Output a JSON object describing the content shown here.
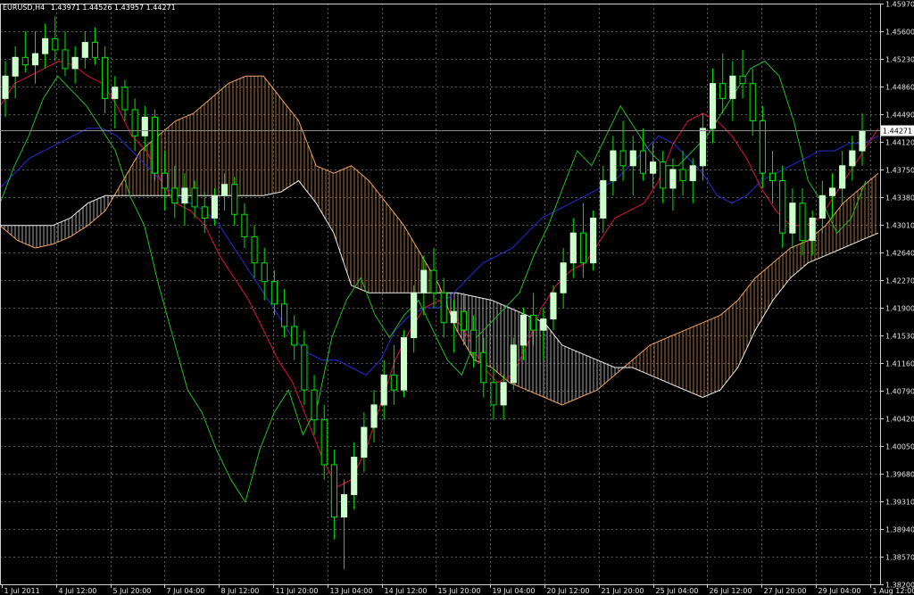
{
  "header": {
    "symbol_tf": "EURUSD,H4",
    "ohlc": "1.43971 1.44526 1.43957 1.44271"
  },
  "current_price_label": "1.44271",
  "colors": {
    "background": "#000000",
    "grid": "#5a5a5a",
    "axis": "#cfcfcf",
    "bull": "#ccffcc",
    "bear": "#228B22",
    "wick": "#00e600",
    "tenkan": "#e0103c",
    "kijun": "#2a2ad8",
    "chikou": "#22bb22",
    "cloud_bull": "#f4a460",
    "cloud_bear": "#f0f0f0"
  },
  "chart_data": {
    "type": "candlestick",
    "ylim": [
      1.382,
      1.4597
    ],
    "y_ticks": [
      "1.45970",
      "1.45600",
      "1.45230",
      "1.44860",
      "1.44490",
      "1.44120",
      "1.43750",
      "1.43380",
      "1.43010",
      "1.42640",
      "1.42270",
      "1.41900",
      "1.41530",
      "1.41160",
      "1.40790",
      "1.40420",
      "1.40050",
      "1.39680",
      "1.39310",
      "1.38940",
      "1.38570",
      "1.38200"
    ],
    "x_ticks": [
      "1 Jul 2011",
      "4 Jul 12:00",
      "5 Jul 20:00",
      "7 Jul 04:00",
      "8 Jul 12:00",
      "11 Jul 20:00",
      "13 Jul 04:00",
      "14 Jul 12:00",
      "15 Jul 20:00",
      "19 Jul 04:00",
      "20 Jul 12:00",
      "21 Jul 20:00",
      "25 Jul 04:00",
      "26 Jul 12:00",
      "27 Jul 20:00",
      "29 Jul 04:00",
      "1 Aug 12:00"
    ],
    "last_price": 1.44271,
    "candles_ohlc": [
      [
        1.447,
        1.452,
        1.4445,
        1.45
      ],
      [
        1.45,
        1.454,
        1.447,
        1.4525
      ],
      [
        1.4525,
        1.456,
        1.4505,
        1.4515
      ],
      [
        1.4515,
        1.456,
        1.449,
        1.453
      ],
      [
        1.453,
        1.457,
        1.451,
        1.455
      ],
      [
        1.455,
        1.458,
        1.452,
        1.4535
      ],
      [
        1.4535,
        1.456,
        1.45,
        1.451
      ],
      [
        1.451,
        1.454,
        1.449,
        1.4525
      ],
      [
        1.4525,
        1.456,
        1.451,
        1.4545
      ],
      [
        1.4545,
        1.4565,
        1.4515,
        1.4525
      ],
      [
        1.4525,
        1.454,
        1.445,
        1.447
      ],
      [
        1.447,
        1.45,
        1.443,
        1.4485
      ],
      [
        1.4485,
        1.4495,
        1.444,
        1.4455
      ],
      [
        1.4455,
        1.447,
        1.44,
        1.442
      ],
      [
        1.442,
        1.446,
        1.44,
        1.4445
      ],
      [
        1.4445,
        1.4455,
        1.436,
        1.437
      ],
      [
        1.437,
        1.44,
        1.432,
        1.435
      ],
      [
        1.435,
        1.438,
        1.431,
        1.433
      ],
      [
        1.433,
        1.437,
        1.43,
        1.435
      ],
      [
        1.435,
        1.436,
        1.431,
        1.4325
      ],
      [
        1.4325,
        1.4345,
        1.429,
        1.431
      ],
      [
        1.431,
        1.435,
        1.43,
        1.434
      ],
      [
        1.434,
        1.437,
        1.432,
        1.4355
      ],
      [
        1.4355,
        1.4365,
        1.43,
        1.4315
      ],
      [
        1.4315,
        1.433,
        1.427,
        1.4285
      ],
      [
        1.4285,
        1.43,
        1.423,
        1.425
      ],
      [
        1.425,
        1.427,
        1.42,
        1.4225
      ],
      [
        1.4225,
        1.424,
        1.418,
        1.4195
      ],
      [
        1.4195,
        1.4215,
        1.415,
        1.4165
      ],
      [
        1.4165,
        1.418,
        1.412,
        1.414
      ],
      [
        1.414,
        1.416,
        1.406,
        1.408
      ],
      [
        1.408,
        1.41,
        1.402,
        1.404
      ],
      [
        1.404,
        1.406,
        1.396,
        1.398
      ],
      [
        1.398,
        1.4,
        1.388,
        1.391
      ],
      [
        1.391,
        1.396,
        1.384,
        1.394
      ],
      [
        1.394,
        1.401,
        1.392,
        1.399
      ],
      [
        1.399,
        1.405,
        1.397,
        1.403
      ],
      [
        1.403,
        1.408,
        1.401,
        1.406
      ],
      [
        1.406,
        1.412,
        1.404,
        1.41
      ],
      [
        1.41,
        1.414,
        1.406,
        1.408
      ],
      [
        1.408,
        1.416,
        1.407,
        1.415
      ],
      [
        1.415,
        1.422,
        1.413,
        1.421
      ],
      [
        1.421,
        1.426,
        1.418,
        1.424
      ],
      [
        1.424,
        1.427,
        1.419,
        1.421
      ],
      [
        1.421,
        1.423,
        1.415,
        1.417
      ],
      [
        1.417,
        1.42,
        1.413,
        1.4185
      ],
      [
        1.4185,
        1.421,
        1.414,
        1.416
      ],
      [
        1.416,
        1.418,
        1.411,
        1.413
      ],
      [
        1.413,
        1.415,
        1.407,
        1.409
      ],
      [
        1.409,
        1.411,
        1.404,
        1.406
      ],
      [
        1.406,
        1.41,
        1.404,
        1.409
      ],
      [
        1.409,
        1.415,
        1.408,
        1.414
      ],
      [
        1.414,
        1.419,
        1.412,
        1.418
      ],
      [
        1.418,
        1.421,
        1.414,
        1.416
      ],
      [
        1.416,
        1.419,
        1.412,
        1.4175
      ],
      [
        1.4175,
        1.422,
        1.416,
        1.421
      ],
      [
        1.421,
        1.427,
        1.419,
        1.425
      ],
      [
        1.425,
        1.431,
        1.423,
        1.429
      ],
      [
        1.429,
        1.433,
        1.423,
        1.425
      ],
      [
        1.425,
        1.432,
        1.424,
        1.431
      ],
      [
        1.431,
        1.438,
        1.429,
        1.436
      ],
      [
        1.436,
        1.442,
        1.434,
        1.44
      ],
      [
        1.44,
        1.444,
        1.436,
        1.438
      ],
      [
        1.438,
        1.442,
        1.434,
        1.44
      ],
      [
        1.44,
        1.443,
        1.436,
        1.437
      ],
      [
        1.437,
        1.441,
        1.435,
        1.4385
      ],
      [
        1.4385,
        1.44,
        1.433,
        1.435
      ],
      [
        1.435,
        1.439,
        1.432,
        1.4375
      ],
      [
        1.4375,
        1.44,
        1.434,
        1.436
      ],
      [
        1.436,
        1.439,
        1.433,
        1.438
      ],
      [
        1.438,
        1.445,
        1.436,
        1.443
      ],
      [
        1.443,
        1.451,
        1.441,
        1.449
      ],
      [
        1.449,
        1.453,
        1.445,
        1.447
      ],
      [
        1.447,
        1.452,
        1.444,
        1.45
      ],
      [
        1.45,
        1.4535,
        1.447,
        1.449
      ],
      [
        1.449,
        1.451,
        1.442,
        1.444
      ],
      [
        1.444,
        1.446,
        1.435,
        1.437
      ],
      [
        1.437,
        1.44,
        1.433,
        1.436
      ],
      [
        1.436,
        1.438,
        1.427,
        1.429
      ],
      [
        1.429,
        1.435,
        1.427,
        1.433
      ],
      [
        1.433,
        1.435,
        1.426,
        1.428
      ],
      [
        1.428,
        1.432,
        1.426,
        1.431
      ],
      [
        1.431,
        1.436,
        1.429,
        1.434
      ],
      [
        1.434,
        1.437,
        1.431,
        1.435
      ],
      [
        1.435,
        1.44,
        1.433,
        1.438
      ],
      [
        1.438,
        1.442,
        1.436,
        1.44
      ],
      [
        1.44,
        1.445,
        1.438,
        1.4427
      ]
    ],
    "tenkan": [
      1.446,
      1.449,
      1.45,
      1.451,
      1.452,
      1.4515,
      1.45,
      1.449,
      1.446,
      1.442,
      1.44,
      1.436,
      1.433,
      1.432,
      1.43,
      1.426,
      1.423,
      1.42,
      1.416,
      1.412,
      1.409,
      1.404,
      1.399,
      1.395,
      1.396,
      1.4,
      1.406,
      1.412,
      1.416,
      1.419,
      1.42,
      1.418,
      1.415,
      1.411,
      1.409,
      1.41,
      1.414,
      1.419,
      1.422,
      1.424,
      1.425,
      1.428,
      1.431,
      1.432,
      1.433,
      1.436,
      1.441,
      1.444,
      1.445,
      1.444,
      1.442,
      1.439,
      1.435,
      1.432,
      1.43,
      1.43,
      1.431,
      1.434,
      1.437,
      1.44,
      1.443
    ],
    "kijun": [
      1.435,
      1.437,
      1.439,
      1.44,
      1.441,
      1.442,
      1.443,
      1.443,
      1.442,
      1.44,
      1.438,
      1.436,
      1.434,
      1.433,
      1.432,
      1.43,
      1.427,
      1.424,
      1.421,
      1.418,
      1.415,
      1.413,
      1.412,
      1.412,
      1.411,
      1.41,
      1.412,
      1.416,
      1.418,
      1.419,
      1.419,
      1.421,
      1.423,
      1.425,
      1.426,
      1.427,
      1.429,
      1.431,
      1.432,
      1.433,
      1.434,
      1.435,
      1.436,
      1.438,
      1.44,
      1.442,
      1.441,
      1.439,
      1.437,
      1.434,
      1.433,
      1.434,
      1.436,
      1.437,
      1.438,
      1.439,
      1.44,
      1.44,
      1.441,
      1.441,
      1.442
    ],
    "chikou": [
      1.433,
      1.438,
      1.442,
      1.447,
      1.45,
      1.448,
      1.446,
      1.443,
      1.44,
      1.434,
      1.43,
      1.422,
      1.415,
      1.408,
      1.405,
      1.4,
      1.396,
      1.393,
      1.4,
      1.405,
      1.408,
      1.402,
      1.406,
      1.415,
      1.42,
      1.423,
      1.418,
      1.415,
      1.418,
      1.42,
      1.416,
      1.412,
      1.41,
      1.415,
      1.417,
      1.419,
      1.421,
      1.426,
      1.43,
      1.435,
      1.44,
      1.438,
      1.442,
      1.446,
      1.443,
      1.44,
      1.438,
      1.438,
      1.44,
      1.442,
      1.445,
      1.448,
      1.451,
      1.452,
      1.45,
      1.444,
      1.436,
      1.433,
      1.429,
      1.431,
      1.436
    ],
    "senkou_a": [
      1.43,
      1.428,
      1.427,
      1.4275,
      1.4285,
      1.43,
      1.432,
      1.436,
      1.44,
      1.442,
      1.444,
      1.445,
      1.447,
      1.449,
      1.45,
      1.45,
      1.447,
      1.444,
      1.438,
      1.437,
      1.438,
      1.436,
      1.433,
      1.43,
      1.426,
      1.422,
      1.416,
      1.412,
      1.411,
      1.409,
      1.408,
      1.407,
      1.406,
      1.407,
      1.408,
      1.41,
      1.412,
      1.414,
      1.415,
      1.416,
      1.417,
      1.418,
      1.42,
      1.423,
      1.425,
      1.427,
      1.428,
      1.43,
      1.433,
      1.435,
      1.437
    ],
    "senkou_b": [
      1.43,
      1.43,
      1.43,
      1.43,
      1.431,
      1.433,
      1.434,
      1.434,
      1.434,
      1.434,
      1.434,
      1.434,
      1.434,
      1.434,
      1.434,
      1.434,
      1.4345,
      1.436,
      1.433,
      1.429,
      1.422,
      1.421,
      1.421,
      1.421,
      1.421,
      1.421,
      1.421,
      1.4205,
      1.42,
      1.419,
      1.418,
      1.417,
      1.414,
      1.413,
      1.412,
      1.411,
      1.411,
      1.41,
      1.409,
      1.408,
      1.407,
      1.408,
      1.411,
      1.416,
      1.42,
      1.423,
      1.425,
      1.426,
      1.427,
      1.428,
      1.429
    ]
  }
}
